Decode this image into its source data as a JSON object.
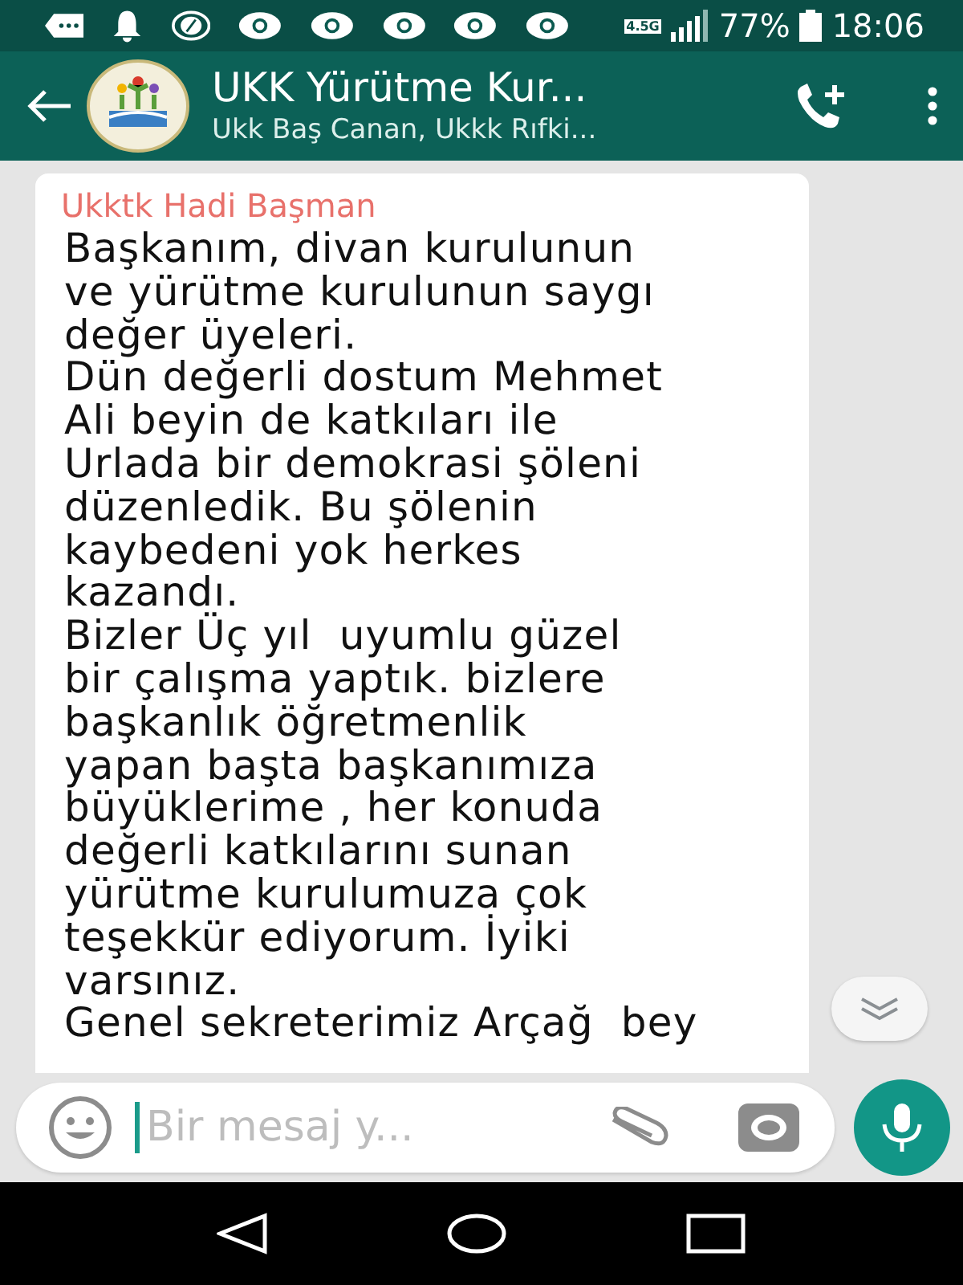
{
  "status_bar": {
    "network": "4.5G",
    "battery": "77%",
    "time": "18:06"
  },
  "header": {
    "title": "UKK Yürütme Kur...",
    "subtitle": "Ukk Baş Canan, Ukkk Rıfki..."
  },
  "message": {
    "sender": "Ukktk Hadi Başman",
    "lines": [
      "Başkanım, divan kurulunun",
      "ve yürütme kurulunun saygı",
      "değer üyeleri.",
      "Dün değerli dostum Mehmet",
      "Ali beyin de katkıları ile",
      "Urlada bir demokrasi şöleni",
      "düzenledik. Bu şölenin",
      "kaybedeni yok herkes",
      "kazandı.",
      "Bizler Üç yıl  uyumlu güzel",
      "bir çalışma yaptık. bizlere",
      "başkanlık öğretmenlik",
      "yapan başta başkanımıza",
      "büyüklerime , her konuda",
      "değerli katkılarını sunan",
      "yürütme kurulumuza çok",
      "teşekkür ediyorum. İyiki",
      "varsınız.",
      "Genel sekreterimiz Arçağ  bey"
    ]
  },
  "input": {
    "placeholder": "Bir mesaj y..."
  }
}
